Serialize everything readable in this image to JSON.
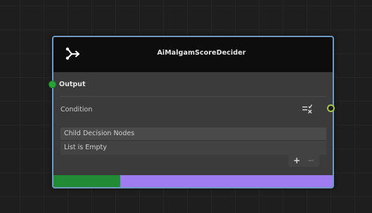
{
  "node": {
    "title": "AiMalgamScoreDecider",
    "header_icon": "branch-arrow-icon",
    "output_label": "Output",
    "condition_label": "Condition",
    "condition_icon": "list-remove-icon",
    "list": {
      "header": "Child Decision Nodes",
      "empty_text": "List is Empty",
      "add_label": "+",
      "remove_label": "−"
    },
    "progress_fraction": 0.24,
    "colors": {
      "border": "#6f9ac2",
      "header_bg": "#0d0d0d",
      "body_bg": "#3b3b3b",
      "input_port": "#27a337",
      "output_port_ring": "#a9c74a",
      "bar_fill": "#218b35",
      "bar_track": "#9f7df0"
    }
  }
}
